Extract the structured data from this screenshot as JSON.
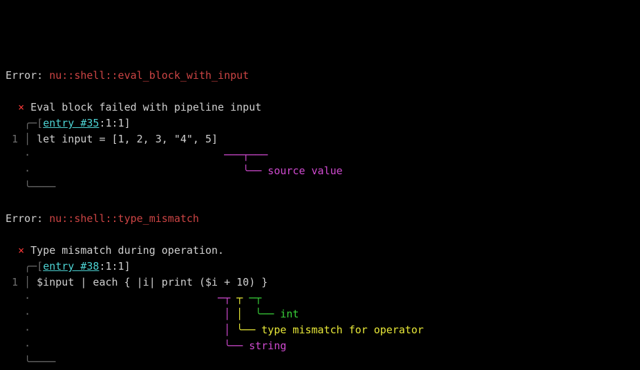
{
  "error1": {
    "prefix": "Error:",
    "code": "nu::shell::eval_block_with_input",
    "x": "×",
    "title": "Eval block failed with pipeline input",
    "frame_top": "   ╭─[",
    "entry_link": "entry #35",
    "entry_rest": ":1:1]",
    "lineno": " 1 ",
    "gutter": "│ ",
    "source": "let input = [1, 2, 3, \"4\", 5]",
    "dot": "   ·",
    "caret": "                               ───┬───",
    "label": "                                  ╰── ",
    "label_text": "source value",
    "frame_bot": "   ╰────"
  },
  "error2": {
    "prefix": "Error:",
    "code": "nu::shell::type_mismatch",
    "x": "×",
    "title": "Type mismatch during operation.",
    "frame_top": "   ╭─[",
    "entry_link": "entry #38",
    "entry_rest": ":1:1]",
    "lineno": " 1 ",
    "gutter": "│ ",
    "source": "$input | each { |i| print ($i + 10) }",
    "dot": "   ·",
    "c1": "                              ─┬ ┬ ─┬",
    "c2": "                               │ │  ╰── ",
    "l2": "int",
    "c3": "                               │ ╰── ",
    "l3": "type mismatch for operator",
    "c4": "                               ╰── ",
    "l4": "string",
    "frame_bot": "   ╰────"
  }
}
